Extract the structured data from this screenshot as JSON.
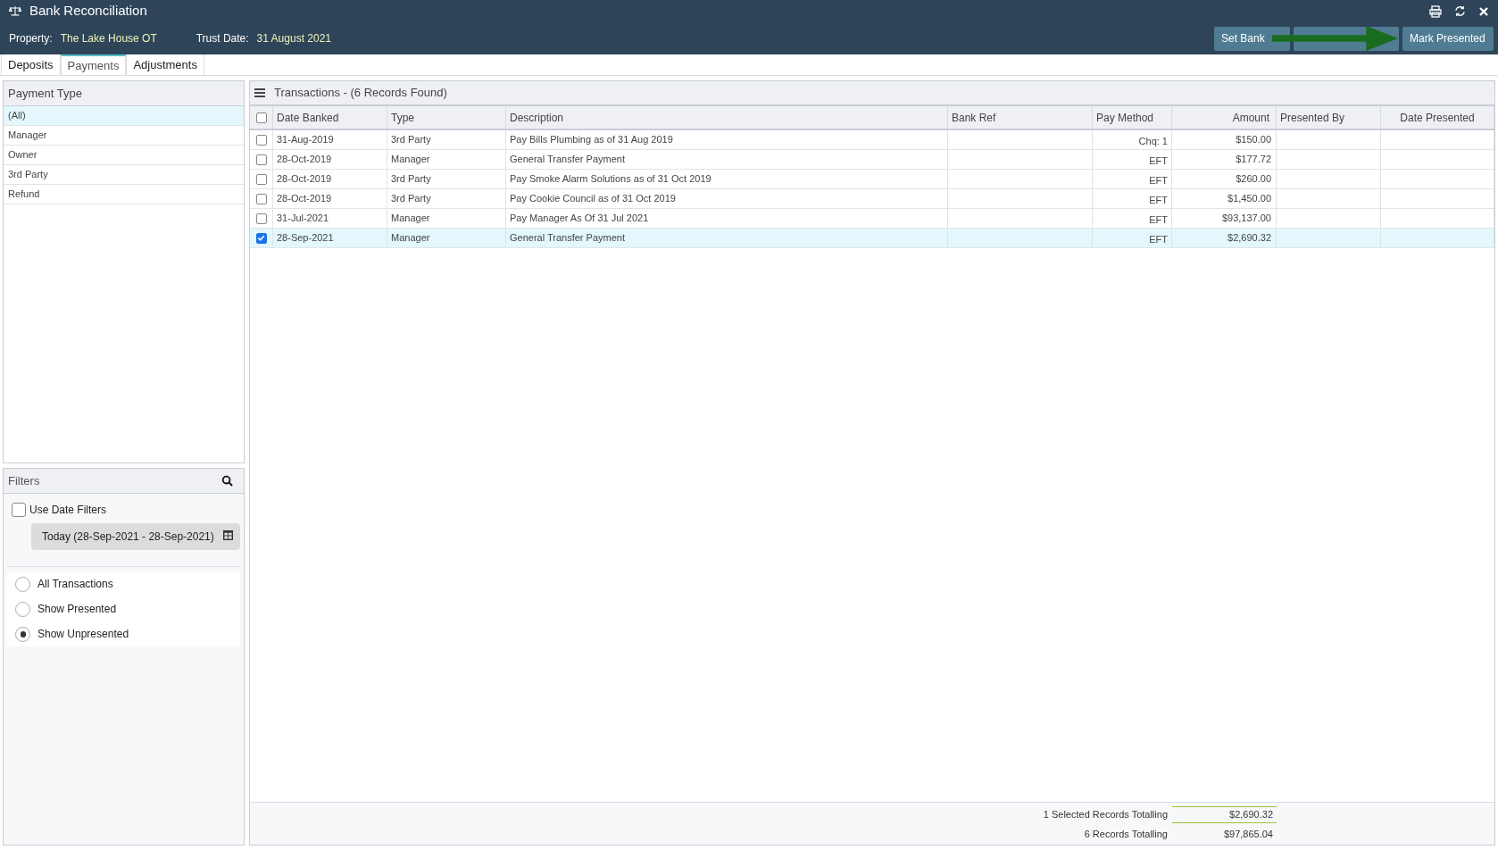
{
  "window": {
    "title": "Bank Reconciliation"
  },
  "header": {
    "property_label": "Property:",
    "property_value": "The Lake House OT",
    "trust_date_label": "Trust Date:",
    "trust_date_value": "31 August 2021",
    "buttons": [
      {
        "label": "Set Bank"
      },
      {
        "kind": "covered"
      },
      {
        "label": "Mark Presented"
      }
    ]
  },
  "tabs": [
    {
      "label": "Deposits",
      "selected": false
    },
    {
      "label": "Payments",
      "selected": true
    },
    {
      "label": "Adjustments",
      "selected": false
    }
  ],
  "payment_type": {
    "title": "Payment Type",
    "items": [
      {
        "label": "(All)",
        "selected": true
      },
      {
        "label": "Manager",
        "selected": false
      },
      {
        "label": "Owner",
        "selected": false
      },
      {
        "label": "3rd Party",
        "selected": false
      },
      {
        "label": "Refund",
        "selected": false
      }
    ]
  },
  "filters": {
    "title": "Filters",
    "use_date_filters": {
      "label": "Use Date Filters",
      "checked": false
    },
    "date_range": "Today (28-Sep-2021 - 28-Sep-2021)",
    "options": [
      {
        "label": "All Transactions",
        "selected": false
      },
      {
        "label": "Show Presented",
        "selected": false
      },
      {
        "label": "Show Unpresented",
        "selected": true
      }
    ]
  },
  "transactions": {
    "title": "Transactions - (6 Records Found)",
    "select_all": false,
    "columns": [
      "Date Banked",
      "Type",
      "Description",
      "Bank Ref",
      "Pay Method",
      "Amount",
      "Presented By",
      "Date Presented"
    ],
    "rows": [
      {
        "checked": false,
        "selected": false,
        "cells": [
          "31-Aug-2019",
          "3rd Party",
          "Pay Bills Plumbing as of 31 Aug 2019",
          "",
          "Chq: 1",
          "$150.00",
          "",
          ""
        ]
      },
      {
        "checked": false,
        "selected": false,
        "cells": [
          "28-Oct-2019",
          "Manager",
          "General Transfer Payment",
          "",
          "EFT",
          "$177.72",
          "",
          ""
        ]
      },
      {
        "checked": false,
        "selected": false,
        "cells": [
          "28-Oct-2019",
          "3rd Party",
          "Pay Smoke Alarm Solutions as of 31 Oct 2019",
          "",
          "EFT",
          "$260.00",
          "",
          ""
        ]
      },
      {
        "checked": false,
        "selected": false,
        "cells": [
          "28-Oct-2019",
          "3rd Party",
          "Pay Cookie Council as of 31 Oct 2019",
          "",
          "EFT",
          "$1,450.00",
          "",
          ""
        ]
      },
      {
        "checked": false,
        "selected": false,
        "cells": [
          "31-Jul-2021",
          "Manager",
          "Pay Manager As Of 31 Jul 2021",
          "",
          "EFT",
          "$93,137.00",
          "",
          ""
        ]
      },
      {
        "checked": true,
        "selected": true,
        "cells": [
          "28-Sep-2021",
          "Manager",
          "General Transfer Payment",
          "",
          "EFT",
          "$2,690.32",
          "",
          ""
        ]
      }
    ],
    "totals": [
      {
        "label": "1 Selected Records Totalling",
        "value": "$2,690.32"
      },
      {
        "label": "6 Records Totalling",
        "value": "$97,865.04"
      }
    ]
  }
}
